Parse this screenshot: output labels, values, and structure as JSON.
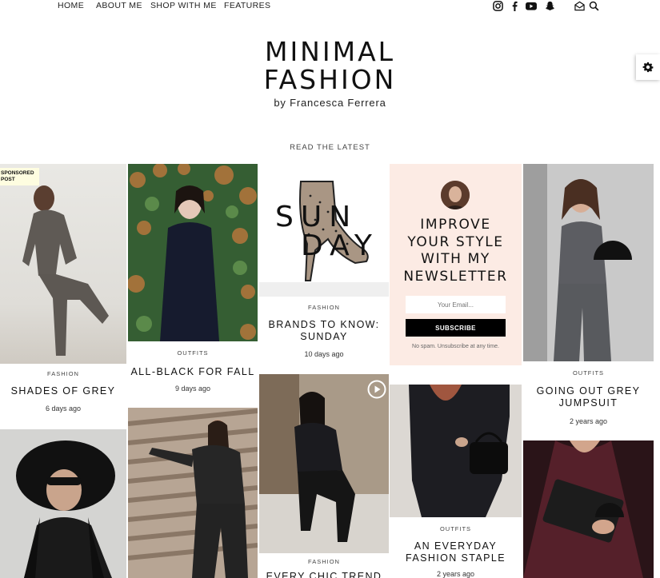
{
  "nav": {
    "items": [
      "HOME",
      "ABOUT ME",
      "SHOP WITH ME",
      "FEATURES"
    ],
    "social_icons": [
      "instagram-icon",
      "facebook-icon",
      "youtube-icon",
      "snapchat-icon",
      "mail-icon",
      "search-icon"
    ]
  },
  "header": {
    "logo_line1": "MINIMAL",
    "logo_line2": "FASHION",
    "byline": "by Francesca Ferrera",
    "settings_icon": "gear-icon"
  },
  "section_title": "READ THE LATEST",
  "posts": [
    {
      "badge": "SPONSORED POST",
      "category": "FASHION",
      "title": "SHADES OF GREY",
      "date": "6 days ago"
    },
    {
      "category": "OUTFITS",
      "title": "ALL-BLACK FOR FALL",
      "date": "9 days ago"
    },
    {
      "overlay_text": [
        "SUN",
        "DAY"
      ],
      "category": "FASHION",
      "title_lines": [
        "BRANDS TO KNOW:",
        "SUNDAY"
      ],
      "date": "10 days ago"
    },
    {
      "category": "OUTFITS",
      "title_lines": [
        "GOING OUT GREY",
        "JUMPSUIT"
      ],
      "date": "2 years ago"
    },
    {
      "category": "OUTFITS",
      "title_lines": [
        "AN EVERYDAY",
        "FASHION STAPLE"
      ],
      "date": "2 years ago"
    },
    {
      "category": "FASHION",
      "title": "EVERY CHIC TREND"
    }
  ],
  "newsletter": {
    "heading_lines": [
      "IMPROVE",
      "YOUR STYLE",
      "WITH MY",
      "NEWSLETTER"
    ],
    "email_placeholder": "Your Email...",
    "button": "SUBSCRIBE",
    "note": "No spam. Unsubscribe at any time."
  },
  "colors": {
    "newsletter_bg": "#fcebe4",
    "sponsored_bg": "#fefde0",
    "subscribe_bg": "#000000"
  }
}
